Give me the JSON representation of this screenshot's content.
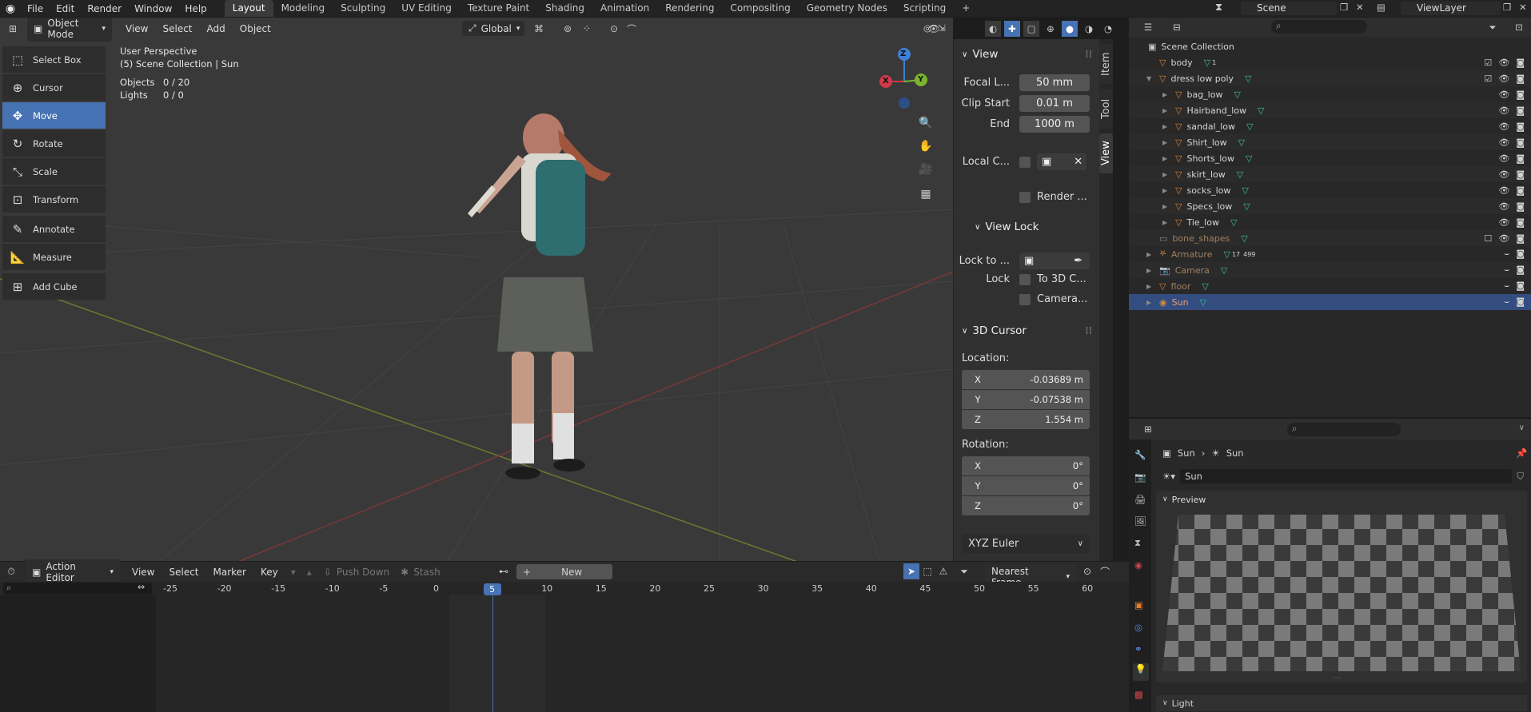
{
  "topbar": {
    "menus": [
      "File",
      "Edit",
      "Render",
      "Window",
      "Help"
    ],
    "workspaces": [
      "Layout",
      "Modeling",
      "Sculpting",
      "UV Editing",
      "Texture Paint",
      "Shading",
      "Animation",
      "Rendering",
      "Compositing",
      "Geometry Nodes",
      "Scripting"
    ],
    "active_workspace": "Layout",
    "add_tab": "+",
    "scene": "Scene",
    "view_layer": "ViewLayer"
  },
  "viewport_header": {
    "mode": "Object Mode",
    "menus": [
      "View",
      "Select",
      "Add",
      "Object"
    ],
    "orientation": "Global"
  },
  "toolbar": [
    "Select Box",
    "Cursor",
    "Move",
    "Rotate",
    "Scale",
    "Transform",
    "Annotate",
    "Measure",
    "Add Cube"
  ],
  "overlay": {
    "perspective": "User Perspective",
    "collection": "(5) Scene Collection | Sun",
    "objects_label": "Objects",
    "objects_value": "0 / 20",
    "lights_label": "Lights",
    "lights_value": "0 / 0"
  },
  "gizmo": {
    "x": "X",
    "y": "Y",
    "z": "Z"
  },
  "npanel": {
    "tabs": [
      "Item",
      "Tool",
      "View"
    ],
    "view_section": "View",
    "focal_label": "Focal L...",
    "focal_value": "50 mm",
    "clip_start_label": "Clip Start",
    "clip_start_value": "0.01 m",
    "end_label": "End",
    "end_value": "1000 m",
    "local_camera_label": "Local C...",
    "render_label": "Render ...",
    "view_lock_section": "View Lock",
    "lock_to_label": "Lock to ...",
    "lock_label": "Lock",
    "to_3d_cursor": "To 3D C...",
    "camera_label": "Camera...",
    "cursor_section": "3D Cursor",
    "location_label": "Location:",
    "loc": [
      {
        "axis": "X",
        "value": "-0.03689 m"
      },
      {
        "axis": "Y",
        "value": "-0.07538 m"
      },
      {
        "axis": "Z",
        "value": "1.554 m"
      }
    ],
    "rotation_label": "Rotation:",
    "rot": [
      {
        "axis": "X",
        "value": "0°"
      },
      {
        "axis": "Y",
        "value": "0°"
      },
      {
        "axis": "Z",
        "value": "0°"
      }
    ],
    "rotation_mode": "XYZ Euler"
  },
  "outliner": {
    "root": "Scene Collection",
    "rows": [
      {
        "name": "body",
        "indent": 1,
        "extra": "1"
      },
      {
        "name": "dress low poly",
        "indent": 1
      },
      {
        "name": "bag_low",
        "indent": 2
      },
      {
        "name": "Hairband_low",
        "indent": 2
      },
      {
        "name": "sandal_low",
        "indent": 2
      },
      {
        "name": "Shirt_low",
        "indent": 2
      },
      {
        "name": "Shorts_low",
        "indent": 2
      },
      {
        "name": "skirt_low",
        "indent": 2
      },
      {
        "name": "socks_low",
        "indent": 2
      },
      {
        "name": "Specs_low",
        "indent": 2
      },
      {
        "name": "Tie_low",
        "indent": 2
      },
      {
        "name": "bone_shapes",
        "indent": 1
      },
      {
        "name": "Armature",
        "indent": 1,
        "extra": "17",
        "extra2": "499"
      },
      {
        "name": "Camera",
        "indent": 1
      },
      {
        "name": "floor",
        "indent": 1
      },
      {
        "name": "Sun",
        "indent": 1
      }
    ]
  },
  "properties": {
    "breadcrumb_1": "Sun",
    "breadcrumb_2": "Sun",
    "datablock": "Sun",
    "preview_section": "Preview",
    "light_section": "Light"
  },
  "timeline": {
    "editor": "Action Editor",
    "menus": [
      "View",
      "Select",
      "Marker",
      "Key"
    ],
    "push_down": "Push Down",
    "stash": "Stash",
    "new_label": "New",
    "snap": "Nearest Frame",
    "ruler": [
      "-25",
      "-20",
      "-15",
      "-10",
      "-5",
      "0",
      "5",
      "10",
      "15",
      "20",
      "25",
      "30",
      "35",
      "40",
      "45",
      "50",
      "55",
      "60"
    ],
    "current_frame": "5"
  }
}
